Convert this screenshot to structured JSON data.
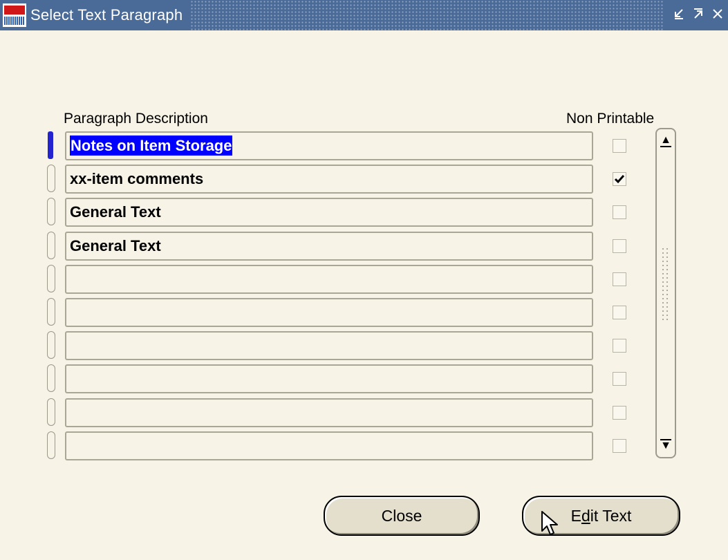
{
  "window": {
    "title": "Select Text Paragraph",
    "controls": [
      "minimize-icon",
      "maximize-icon",
      "close-icon"
    ]
  },
  "columns": {
    "description": "Paragraph Description",
    "non_printable": "Non Printable"
  },
  "rows": [
    {
      "description": "Notes on Item Storage",
      "non_printable": false,
      "current": true
    },
    {
      "description": "xx-item comments",
      "non_printable": true,
      "current": false
    },
    {
      "description": "General Text",
      "non_printable": false,
      "current": false
    },
    {
      "description": "General Text",
      "non_printable": false,
      "current": false
    },
    {
      "description": "",
      "non_printable": false,
      "current": false
    },
    {
      "description": "",
      "non_printable": false,
      "current": false
    },
    {
      "description": "",
      "non_printable": false,
      "current": false
    },
    {
      "description": "",
      "non_printable": false,
      "current": false
    },
    {
      "description": "",
      "non_printable": false,
      "current": false
    },
    {
      "description": "",
      "non_printable": false,
      "current": false
    }
  ],
  "buttons": {
    "close": "Close",
    "edit_prefix": "E",
    "edit_mnemonic": "d",
    "edit_suffix": "it Text"
  },
  "colors": {
    "titlebar": "#4a6a98",
    "selection": "#0000ff",
    "background": "#f7f3e7"
  }
}
